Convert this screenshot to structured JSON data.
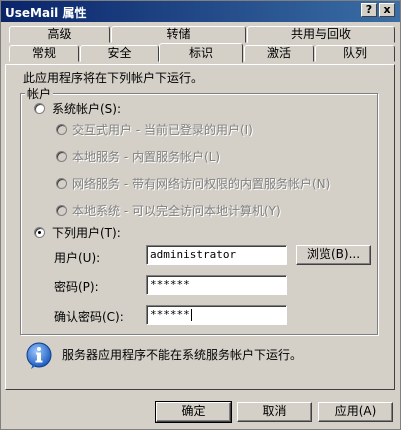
{
  "window": {
    "title": "UseMail 属性",
    "help_symbol": "?",
    "close_symbol": "x"
  },
  "tabs": {
    "row1": [
      "高级",
      "转储",
      "共用与回收"
    ],
    "row2": [
      "常规",
      "安全",
      "标识",
      "激活",
      "队列"
    ],
    "active": "标识"
  },
  "identity": {
    "intro": "此应用程序将在下列帐户下运行。",
    "group_label": "帐户",
    "system_account": "系统帐户(S):",
    "system_options": [
      "交互式用户 - 当前已登录的用户(I)",
      "本地服务 - 内置服务帐户(L)",
      "网络服务 - 带有网络访问权限的内置服务帐户(N)",
      "本地系统 - 可以完全访问本地计算机(Y)"
    ],
    "this_user": "下列用户(T):",
    "user_label": "用户(U):",
    "user_value": "administrator",
    "browse_label": "浏览(B)...",
    "password_label": "密码(P):",
    "password_value": "******",
    "confirm_label": "确认密码(C):",
    "confirm_value": "******",
    "info_text": "服务器应用程序不能在系统服务帐户下运行。"
  },
  "footer": {
    "ok": "确定",
    "cancel": "取消",
    "apply": "应用(A)"
  },
  "icons": {
    "info": "info-icon"
  },
  "colors": {
    "title_start": "#0a246a",
    "title_end": "#3a6ea5",
    "face": "#d4d0c8",
    "info_blue": "#1f5fbf"
  }
}
